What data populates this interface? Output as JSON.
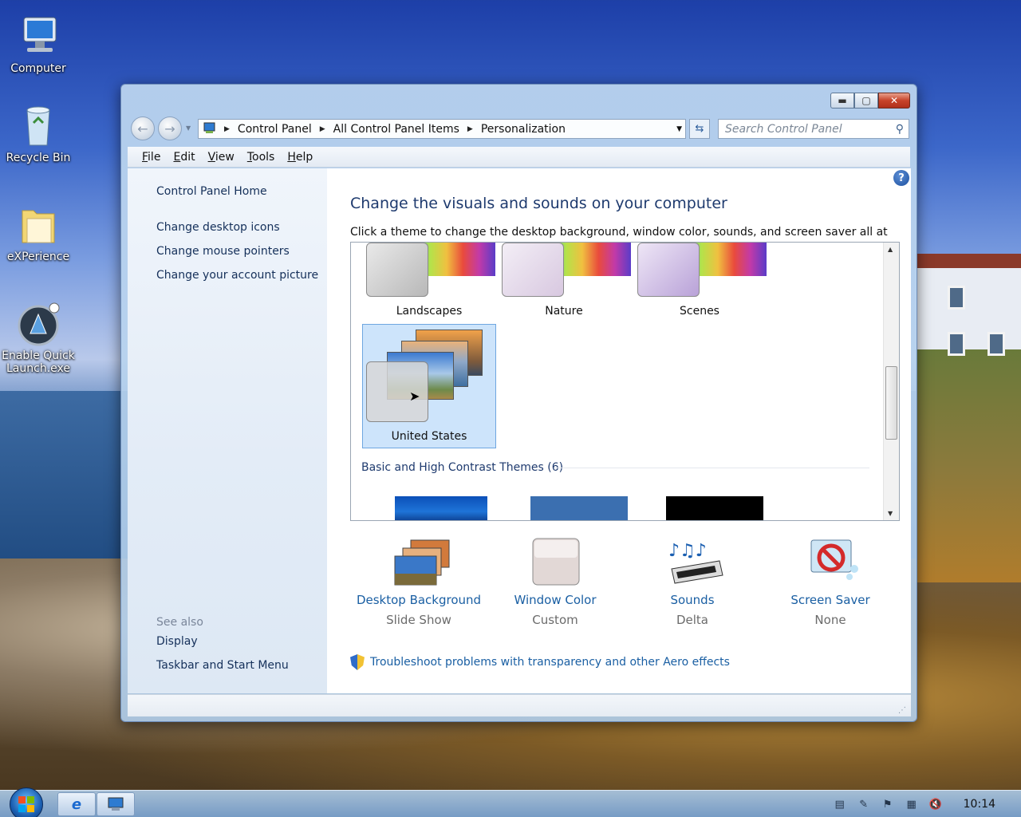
{
  "desktop": {
    "icons": [
      {
        "label": "Computer"
      },
      {
        "label": "Recycle Bin"
      },
      {
        "label": "eXPerience"
      },
      {
        "label": "Enable Quick Launch.exe"
      }
    ]
  },
  "window": {
    "caption": {
      "minimize": "▬",
      "maximize": "▢",
      "close": "✕"
    },
    "address": {
      "crumbs": [
        "Control Panel",
        "All Control Panel Items",
        "Personalization"
      ]
    },
    "search": {
      "placeholder": "Search Control Panel"
    },
    "menu": [
      "File",
      "Edit",
      "View",
      "Tools",
      "Help"
    ],
    "left_pane": {
      "links": [
        "Control Panel Home",
        "Change desktop icons",
        "Change mouse pointers",
        "Change your account picture"
      ],
      "see_also_label": "See also",
      "see_also_links": [
        "Display",
        "Taskbar and Start Menu"
      ]
    },
    "main": {
      "heading": "Change the visuals and sounds on your computer",
      "subheading": "Click a theme to change the desktop background, window color, sounds, and screen saver all at once.",
      "themes": [
        {
          "label": "Landscapes"
        },
        {
          "label": "Nature"
        },
        {
          "label": "Scenes"
        },
        {
          "label": "United States",
          "selected": true
        }
      ],
      "basic_section": "Basic and High Contrast Themes (6)",
      "bottom": [
        {
          "label": "Desktop Background",
          "sub": "Slide Show"
        },
        {
          "label": "Window Color",
          "sub": "Custom"
        },
        {
          "label": "Sounds",
          "sub": "Delta"
        },
        {
          "label": "Screen Saver",
          "sub": "None"
        }
      ],
      "troubleshoot": "Troubleshoot problems with transparency and other Aero effects"
    }
  },
  "taskbar": {
    "clock": "10:14"
  },
  "colors": {
    "link": "#1a5fa3",
    "heading": "#1e3a6e",
    "selection": "#cde4fb"
  }
}
